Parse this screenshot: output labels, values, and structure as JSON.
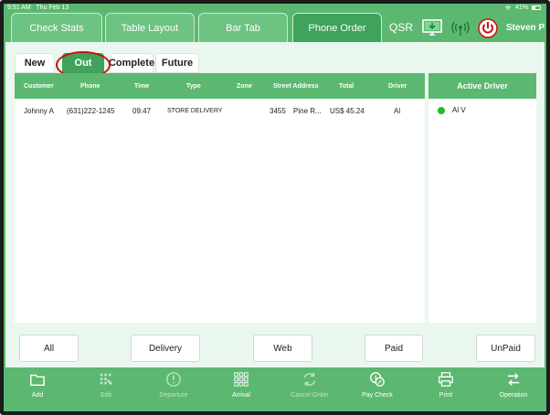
{
  "status_bar": {
    "time": "9:51 AM",
    "date": "Thu Feb 13",
    "battery": "41%"
  },
  "top_tabs": [
    {
      "label": "Check Stats",
      "active": false
    },
    {
      "label": "Table Layout",
      "active": false
    },
    {
      "label": "Bar Tab",
      "active": false
    },
    {
      "label": "Phone Order",
      "active": true
    }
  ],
  "qsr_label": "QSR",
  "user_name": "Steven P",
  "sub_tabs": [
    {
      "label": "New",
      "active": false
    },
    {
      "label": "Out",
      "active": true
    },
    {
      "label": "Complete",
      "active": false
    },
    {
      "label": "Future",
      "active": false
    }
  ],
  "orders_table": {
    "columns": [
      "Customer",
      "Phone",
      "Time",
      "Type",
      "Zone",
      "Street Address",
      "Total",
      "Driver"
    ],
    "rows": [
      {
        "customer": "Johnny A",
        "phone": "(631)222-1245",
        "time": "09:47",
        "type": "STORE DELIVERY",
        "zone": "",
        "street_number": "3455",
        "street": "Pine R...",
        "total": "US$ 45.24",
        "driver": "Al"
      }
    ]
  },
  "active_driver": {
    "title": "Active Driver",
    "drivers": [
      {
        "name": "Al V",
        "status_color": "#22bb22"
      }
    ]
  },
  "filters": [
    "All",
    "Delivery",
    "Web",
    "Paid",
    "UnPaid"
  ],
  "toolbar": [
    {
      "label": "Add",
      "icon": "folder-icon",
      "enabled": true
    },
    {
      "label": "Edit",
      "icon": "grid-edit-icon",
      "enabled": false
    },
    {
      "label": "Departure",
      "icon": "clock-alert-icon",
      "enabled": false
    },
    {
      "label": "Arrival",
      "icon": "grid-icon",
      "enabled": true
    },
    {
      "label": "Cancel Order",
      "icon": "cancel-arrows-icon",
      "enabled": false
    },
    {
      "label": "Pay Check",
      "icon": "coins-icon",
      "enabled": true
    },
    {
      "label": "Print",
      "icon": "printer-icon",
      "enabled": true
    },
    {
      "label": "Operation",
      "icon": "swap-icon",
      "enabled": true
    }
  ],
  "colors": {
    "primary_green": "#5cb870",
    "active_green": "#3fa35b",
    "power_red": "#cc1111",
    "highlight_red": "#cc1111"
  }
}
